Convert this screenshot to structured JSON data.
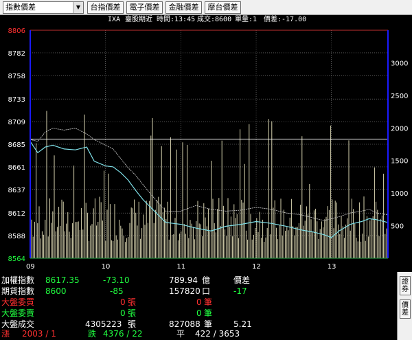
{
  "toolbar": {
    "select_value": "指數價差",
    "buttons": [
      "台指價差",
      "電子價差",
      "金融價差",
      "摩台價差"
    ]
  },
  "info": {
    "code": "IXA",
    "product": "臺股期近",
    "time_label": "時間:13:45",
    "volume_label": "成交:8600",
    "qty_label": "單量:1",
    "spread_label": "價差:-17.00"
  },
  "chart_data": {
    "type": "line",
    "y_axis_price": {
      "ticks": [
        8806,
        8782,
        8758,
        8733,
        8709,
        8685,
        8661,
        8637,
        8612,
        8588,
        8564
      ],
      "range": [
        8564,
        8806
      ]
    },
    "y_axis_volume": {
      "ticks": [
        3000,
        2500,
        2000,
        1500,
        1000,
        500
      ],
      "range": [
        0,
        3500
      ]
    },
    "x_axis": {
      "ticks": [
        "09",
        "10",
        "11",
        "12",
        "13"
      ],
      "range": [
        9,
        13.75
      ]
    },
    "reference_price": 8690.45,
    "series": [
      {
        "color": "#7fe0e8",
        "points": [
          [
            9.0,
            8688
          ],
          [
            9.1,
            8676
          ],
          [
            9.2,
            8682
          ],
          [
            9.3,
            8684
          ],
          [
            9.45,
            8680
          ],
          [
            9.6,
            8679
          ],
          [
            9.75,
            8682
          ],
          [
            9.85,
            8667
          ],
          [
            10.0,
            8662
          ],
          [
            10.1,
            8661
          ],
          [
            10.2,
            8655
          ],
          [
            10.3,
            8647
          ],
          [
            10.4,
            8636
          ],
          [
            10.5,
            8626
          ],
          [
            10.6,
            8618
          ],
          [
            10.8,
            8602
          ],
          [
            11.0,
            8600
          ],
          [
            11.2,
            8596
          ],
          [
            11.4,
            8593
          ],
          [
            11.6,
            8598
          ],
          [
            11.8,
            8600
          ],
          [
            12.0,
            8603
          ],
          [
            12.2,
            8601
          ],
          [
            12.4,
            8598
          ],
          [
            12.6,
            8594
          ],
          [
            12.75,
            8592
          ],
          [
            12.9,
            8589
          ],
          [
            13.0,
            8586
          ],
          [
            13.1,
            8593
          ],
          [
            13.25,
            8600
          ],
          [
            13.4,
            8603
          ],
          [
            13.5,
            8606
          ],
          [
            13.6,
            8605
          ],
          [
            13.75,
            8602
          ]
        ]
      },
      {
        "color": "#bdbdbd",
        "points": [
          [
            9.0,
            8690
          ],
          [
            9.1,
            8688
          ],
          [
            9.2,
            8698
          ],
          [
            9.3,
            8702
          ],
          [
            9.45,
            8700
          ],
          [
            9.6,
            8702
          ],
          [
            9.75,
            8696
          ],
          [
            9.85,
            8690
          ],
          [
            10.0,
            8684
          ],
          [
            10.1,
            8680
          ],
          [
            10.2,
            8670
          ],
          [
            10.3,
            8660
          ],
          [
            10.4,
            8652
          ],
          [
            10.5,
            8642
          ],
          [
            10.6,
            8632
          ],
          [
            10.8,
            8614
          ],
          [
            11.0,
            8614
          ],
          [
            11.2,
            8620
          ],
          [
            11.4,
            8616
          ],
          [
            11.6,
            8614
          ],
          [
            11.8,
            8615
          ],
          [
            12.0,
            8618
          ],
          [
            12.2,
            8616
          ],
          [
            12.4,
            8612
          ],
          [
            12.6,
            8610
          ],
          [
            12.75,
            8607
          ],
          [
            12.9,
            8604
          ],
          [
            13.0,
            8606
          ],
          [
            13.1,
            8608
          ],
          [
            13.25,
            8612
          ],
          [
            13.4,
            8614
          ],
          [
            13.5,
            8616
          ],
          [
            13.6,
            8612
          ],
          [
            13.75,
            8610
          ]
        ]
      }
    ]
  },
  "stats": {
    "r1": {
      "label": "加權指數",
      "value": "8617.35",
      "change": "-73.10",
      "amount": "789.94",
      "unit": "億",
      "right": "價差"
    },
    "r2": {
      "label": "期貨指數",
      "value": "8600",
      "change": "-85",
      "amount": "157820",
      "unit": "口",
      "right": "-17"
    },
    "r3": {
      "label": "大盤委買",
      "value": "0",
      "unit1": "張",
      "value2": "0",
      "unit2": "筆"
    },
    "r4": {
      "label": "大盤委賣",
      "value": "0",
      "unit1": "張",
      "value2": "0",
      "unit2": "筆"
    },
    "r5": {
      "label": "大盤成交",
      "value": "4305223",
      "unit1": "張",
      "value2": "827088",
      "unit2": "筆",
      "extra": "5.21"
    },
    "r6": {
      "label": "漲",
      "value": "2003 / 1",
      "label2": "跌",
      "value2": "4376 / 22",
      "label3": "平",
      "value3": "422 / 3653"
    }
  },
  "side_buttons": [
    "證券",
    "價差"
  ],
  "colors": {
    "up": "#ff3030",
    "down": "#20ff40",
    "price_line": "#7fe0e8",
    "index_line": "#bdbdbd",
    "axis": "#1a1aff",
    "ref_line": "#ffffff"
  }
}
